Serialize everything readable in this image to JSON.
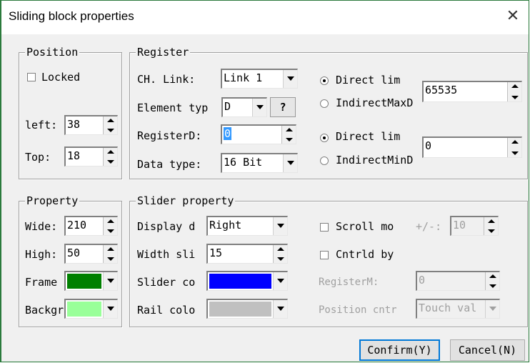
{
  "window": {
    "title": "Sliding block properties",
    "close_glyph": "✕"
  },
  "position": {
    "legend": "Position",
    "locked_label": "Locked",
    "locked_checked": false,
    "left_label": "left:",
    "left_value": "38",
    "top_label": "Top:",
    "top_value": "18"
  },
  "register": {
    "legend": "Register",
    "ch_link_label": "CH. Link:",
    "ch_link_value": "Link 1",
    "element_type_label": "Element typ",
    "element_type_value": "D",
    "help_label": "?",
    "register_d_label": "RegisterD:",
    "register_d_value": "0",
    "data_type_label": "Data type:",
    "data_type_value": "16 Bit",
    "max_direct_label": "Direct lim",
    "max_indirect_label": "IndirectMaxD",
    "max_value": "65535",
    "min_direct_label": "Direct lim",
    "min_indirect_label": "IndirectMinD",
    "min_value": "0"
  },
  "property": {
    "legend": "Property",
    "wide_label": "Wide:",
    "wide_value": "210",
    "high_label": "High:",
    "high_value": "50",
    "frame_label": "Frame",
    "frame_color": "#008000",
    "background_label": "Backgr",
    "background_color": "#99ff99"
  },
  "slider": {
    "legend": "Slider property",
    "display_dir_label": "Display d",
    "display_dir_value": "Right",
    "width_slider_label": "Width sli",
    "width_slider_value": "15",
    "slider_color_label": "Slider co",
    "slider_color": "#0000ff",
    "rail_color_label": "Rail colo",
    "rail_color": "#c0c0c0",
    "scroll_label": "Scroll mo",
    "scroll_checked": false,
    "step_label": "+/-:",
    "step_value": "10",
    "cntrld_label": "Cntrld by",
    "cntrld_checked": false,
    "register_m_label": "RegisterM:",
    "register_m_value": "0",
    "position_ctrl_label": "Position cntr",
    "position_ctrl_value": "Touch val"
  },
  "buttons": {
    "confirm": "Confirm(Y)",
    "cancel": "Cancel(N)"
  }
}
